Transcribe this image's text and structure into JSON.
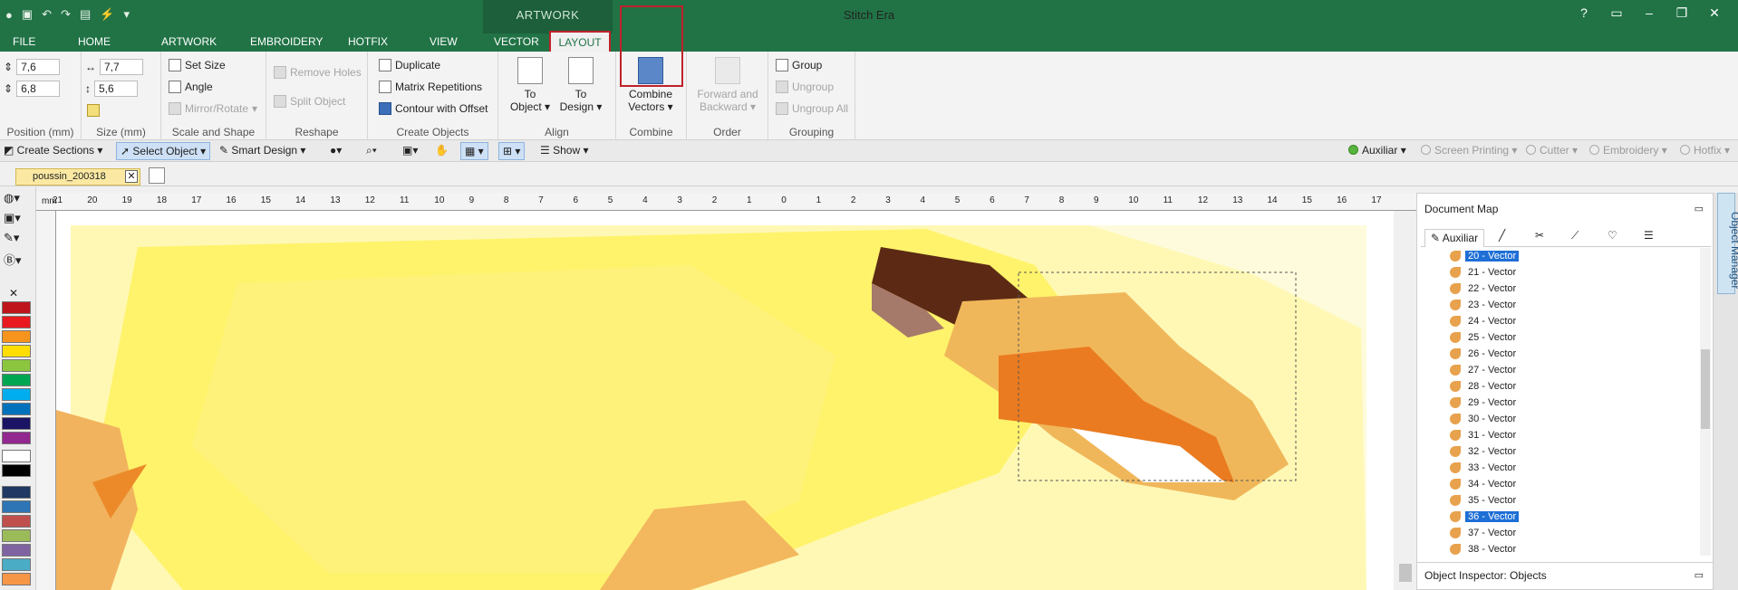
{
  "app": {
    "title": "Stitch Era",
    "context_tab": "ARTWORK"
  },
  "tabs": [
    "FILE",
    "HOME",
    "ARTWORK",
    "EMBROIDERY",
    "HOTFIX",
    "VIEW",
    "VECTOR",
    "LAYOUT"
  ],
  "ribbon": {
    "position": {
      "x": "7,6",
      "y": "6,8",
      "label": "Position (mm)"
    },
    "size": {
      "w": "7,7",
      "h": "5,6",
      "label": "Size (mm)"
    },
    "scale": {
      "items": [
        "Set Size",
        "Angle",
        "Mirror/Rotate"
      ],
      "label": "Scale and Shape"
    },
    "reshape": {
      "items": [
        "Remove Holes",
        "Split Object"
      ],
      "label": "Reshape"
    },
    "create": {
      "items": [
        "Duplicate",
        "Matrix Repetitions",
        "Contour with Offset"
      ],
      "label": "Create Objects"
    },
    "align": {
      "to_object": [
        "To",
        "Object"
      ],
      "to_design": [
        "To",
        "Design"
      ],
      "label": "Align"
    },
    "combine": {
      "button": [
        "Combine",
        "Vectors"
      ],
      "label": "Combine"
    },
    "order": {
      "button": [
        "Forward and",
        "Backward"
      ],
      "label": "Order"
    },
    "grouping": {
      "items": [
        "Group",
        "Ungroup",
        "Ungroup All"
      ],
      "label": "Grouping"
    }
  },
  "toolbar": {
    "create_sections": "Create Sections",
    "select_object": "Select Object",
    "smart_design": "Smart Design",
    "show": "Show",
    "modes": [
      "Auxiliar",
      "Screen Printing",
      "Cutter",
      "Embroidery",
      "Hotfix"
    ]
  },
  "document": {
    "tab": "poussin_200318"
  },
  "ruler": {
    "unit": "mm",
    "labels": [
      "21",
      "20",
      "19",
      "18",
      "17",
      "16",
      "15",
      "14",
      "13",
      "12",
      "11",
      "10",
      "9",
      "8",
      "7",
      "6",
      "5",
      "4",
      "3",
      "2",
      "1",
      "0",
      "1",
      "2",
      "3",
      "4",
      "5",
      "6",
      "7",
      "8",
      "9",
      "10",
      "11",
      "12",
      "13",
      "14",
      "15",
      "16",
      "17"
    ]
  },
  "document_map": {
    "title": "Document Map",
    "tab": "Auxiliar",
    "items": [
      "20 - Vector",
      "21 - Vector",
      "22 - Vector",
      "23 - Vector",
      "24 - Vector",
      "25 - Vector",
      "26 - Vector",
      "27 - Vector",
      "28 - Vector",
      "29 - Vector",
      "30 - Vector",
      "31 - Vector",
      "32 - Vector",
      "33 - Vector",
      "34 - Vector",
      "35 - Vector",
      "36 - Vector",
      "37 - Vector",
      "38 - Vector"
    ],
    "selected": [
      "20 - Vector",
      "36 - Vector"
    ]
  },
  "object_inspector": "Object Inspector: Objects",
  "side_panel": "Object Manager",
  "colors": {
    "accent": "#217346",
    "highlight": "#c0212a",
    "selection": "#1e6fd6"
  }
}
